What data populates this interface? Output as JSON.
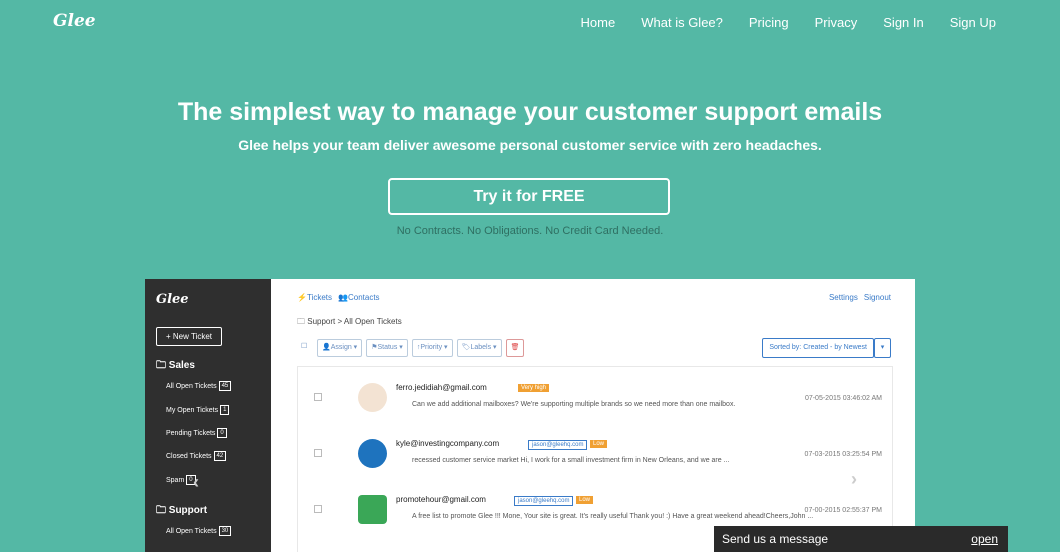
{
  "nav": {
    "logo": "Glee",
    "links": [
      "Home",
      "What is Glee?",
      "Pricing",
      "Privacy",
      "Sign In",
      "Sign Up"
    ]
  },
  "hero": {
    "title": "The simplest way to manage your customer support emails",
    "subtitle": "Glee helps your team deliver awesome personal customer service with zero headaches.",
    "cta": "Try it for FREE",
    "note": "No Contracts. No Obligations. No Credit Card Needed."
  },
  "app": {
    "logo": "Glee",
    "new_ticket": "+ New Ticket",
    "sections": [
      {
        "title": "Sales",
        "items": [
          {
            "label": "All Open Tickets",
            "count": "45"
          },
          {
            "label": "My Open Tickets",
            "count": "1"
          },
          {
            "label": "Pending Tickets",
            "count": "0"
          },
          {
            "label": "Closed Tickets",
            "count": "42"
          },
          {
            "label": "Spam",
            "count": "0"
          }
        ]
      },
      {
        "title": "Support",
        "items": [
          {
            "label": "All Open Tickets",
            "count": "30"
          }
        ]
      }
    ],
    "tabs": [
      "Tickets",
      "Contacts"
    ],
    "toplinks": [
      "Settings",
      "Signout"
    ],
    "breadcrumb": "Support > All Open Tickets",
    "toolbar": [
      "Assign",
      "Status",
      "Priority",
      "Labels"
    ],
    "sort": "Sorted by: Created - by Newest",
    "tickets": [
      {
        "email": "ferro.jedidiah@gmail.com",
        "tags": [
          {
            "text": "Very high",
            "style": "orange"
          }
        ],
        "subject": "Can we add additional mailboxes? We're supporting multiple brands so we need more than one mailbox.",
        "date": "07-05-2015 03:46:02 AM",
        "avatar_color": "#f3e3d3"
      },
      {
        "email": "kyle@investingcompany.com",
        "tags": [
          {
            "text": "jason@gleehq.com",
            "style": "blue"
          },
          {
            "text": "Low",
            "style": "orange"
          }
        ],
        "subject": "recessed customer service market      Hi, I work for a small investment firm in New Orleans, and we are ...",
        "date": "07-03-2015 03:25:54 PM",
        "avatar_color": "#1e73be"
      },
      {
        "email": "promotehour@gmail.com",
        "tags": [
          {
            "text": "jason@gleehq.com",
            "style": "blue"
          },
          {
            "text": "Low",
            "style": "orange"
          }
        ],
        "subject": "A free list to promote Glee !!! Mone, Your site is great. It's really useful Thank you! :) Have a great weekend ahead!Cheers,John ...",
        "date": "07-00-2015 02:55:37 PM",
        "avatar_color": "#3aa757"
      }
    ]
  },
  "chat": {
    "label": "Send us a message",
    "open": "open"
  }
}
